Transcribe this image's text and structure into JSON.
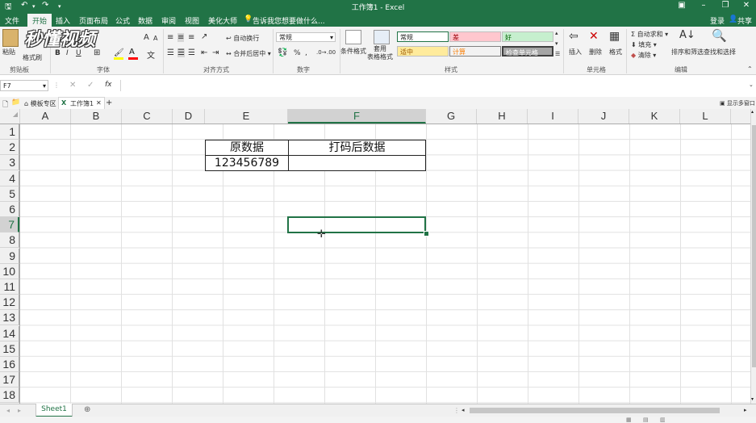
{
  "window": {
    "title": "工作簿1 - Excel"
  },
  "menu": {
    "file": "文件",
    "home": "开始",
    "insert": "插入",
    "page_layout": "页面布局",
    "formulas": "公式",
    "data": "数据",
    "review": "审阅",
    "view": "视图",
    "beautify": "美化大师",
    "tell_me": "告诉我您想要做什么...",
    "login": "登录",
    "share": "共享"
  },
  "watermark": "秒懂视频",
  "ribbon": {
    "clipboard": {
      "paste": "粘贴",
      "format_painter": "格式刷",
      "label": "剪贴板"
    },
    "font": {
      "bold": "B",
      "italic": "I",
      "underline": "U",
      "label": "字体",
      "grow": "A",
      "shrink": "A"
    },
    "alignment": {
      "wrap": "自动换行",
      "merge": "合并后居中",
      "label": "对齐方式"
    },
    "number": {
      "format": "常规",
      "percent": "%",
      "comma": ",",
      "label": "数字"
    },
    "styles": {
      "conditional": "条件格式",
      "table": "套用\n表格格式",
      "normal": "常规",
      "bad": "差",
      "good": "好",
      "neutral": "适中",
      "calc": "计算",
      "check": "检查单元格",
      "label": "样式"
    },
    "cells": {
      "insert": "插入",
      "delete": "删除",
      "format": "格式",
      "label": "单元格"
    },
    "editing": {
      "autosum": "自动求和",
      "fill": "填充",
      "clear": "清除",
      "sort": "排序和筛选",
      "find": "查找和选择",
      "label": "编辑"
    }
  },
  "formula_bar": {
    "name_box": "F7",
    "fx": "fx",
    "formula": ""
  },
  "tabs": {
    "template": "模板专区",
    "workbook": "工作簿1",
    "add": "+",
    "right": "显示多窗口"
  },
  "columns": [
    "A",
    "B",
    "C",
    "D",
    "E",
    "F",
    "G",
    "H",
    "I",
    "J",
    "K",
    "L"
  ],
  "rows": [
    "1",
    "2",
    "3",
    "4",
    "5",
    "6",
    "7",
    "8",
    "9",
    "10",
    "11",
    "12",
    "13",
    "14",
    "15",
    "16",
    "17",
    "18"
  ],
  "cells": {
    "E2": "原数据",
    "F2": "打码后数据",
    "E3": "123456789",
    "F3": ""
  },
  "selected": {
    "cell": "F7",
    "column": "F",
    "row": "7"
  },
  "sheet": {
    "name": "Sheet1"
  },
  "colors": {
    "accent": "#217346",
    "bad_bg": "#ffc7ce",
    "bad_fg": "#9c0006",
    "good_bg": "#c6efce",
    "good_fg": "#006100",
    "neutral_bg": "#ffeb9c",
    "neutral_fg": "#9c5700",
    "check_bg": "#a5a5a5"
  }
}
